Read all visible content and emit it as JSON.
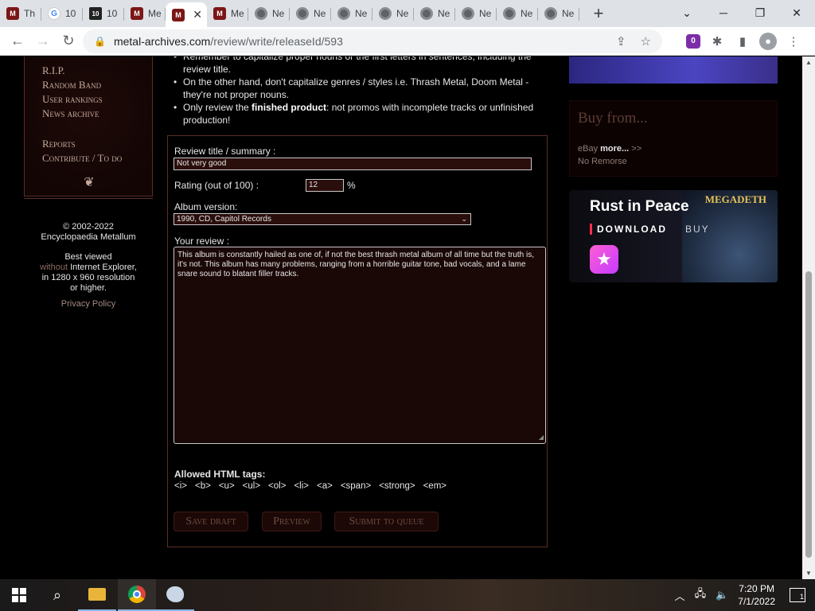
{
  "browser": {
    "tabs": [
      {
        "label": "Th",
        "icon": "ma"
      },
      {
        "label": "10",
        "icon": "g"
      },
      {
        "label": "10",
        "icon": "ten"
      },
      {
        "label": "Me",
        "icon": "ma"
      },
      {
        "label": "",
        "icon": "ma",
        "active": true
      },
      {
        "label": "Me",
        "icon": "ma"
      },
      {
        "label": "Ne",
        "icon": "ch"
      },
      {
        "label": "Ne",
        "icon": "ch"
      },
      {
        "label": "Ne",
        "icon": "ch"
      },
      {
        "label": "Ne",
        "icon": "ch"
      },
      {
        "label": "Ne",
        "icon": "ch"
      },
      {
        "label": "Ne",
        "icon": "ch"
      },
      {
        "label": "Ne",
        "icon": "ch"
      },
      {
        "label": "Ne",
        "icon": "ch"
      }
    ],
    "new_tab": "+",
    "url_host": "metal-archives.com",
    "url_path": "/review/write/releaseId/593",
    "ext_badge": "0"
  },
  "sidebar": {
    "menu": [
      "R.I.P.",
      "Random Band",
      "User rankings",
      "News archive",
      "Reports",
      "Contribute / To do"
    ],
    "copyright_line1": "© 2002-2022",
    "copyright_line2": "Encyclopaedia Metallum",
    "best_viewed_1": "Best viewed",
    "best_viewed_without": "without",
    "best_viewed_2": " Internet Explorer,",
    "best_viewed_3": "in 1280 x 960 resolution",
    "best_viewed_4": "or higher.",
    "privacy": "Privacy Policy"
  },
  "guidelines": {
    "item1": "Remember to capitalize proper nouns or the first letters in sentences, including the review title.",
    "item2": "On the other hand, don't capitalize genres / styles i.e. Thrash Metal, Doom Metal - they're not proper nouns.",
    "item3_pre": "Only review the ",
    "item3_bold": "finished product",
    "item3_post": ": not promos with incomplete tracks or unfinished production!"
  },
  "form": {
    "title_label": "Review title / summary :",
    "title_value": "Not very good",
    "rating_label": "Rating (out of 100) :",
    "rating_value": "12",
    "rating_unit": "%",
    "album_label": "Album version:",
    "album_value": "1990, CD, Capitol Records",
    "review_label": "Your review :",
    "review_text": "This album is constantly hailed as one of, if not the best thrash metal album of all time but the truth is, it's not. This album has many problems, ranging from a horrible guitar tone, bad vocals, and a lame snare sound to blatant filler tracks.",
    "allowed_label": "Allowed HTML tags:",
    "tags": [
      "<i>",
      "<b>",
      "<u>",
      "<ul>",
      "<ol>",
      "<li>",
      "<a>",
      "<span>",
      "<strong>",
      "<em>"
    ],
    "save_draft": "Save draft",
    "preview": "Preview",
    "submit": "Submit to queue"
  },
  "right": {
    "buy_title": "Buy from...",
    "ebay": "eBay ",
    "more": "more...",
    "arrows": " >>",
    "no_remorse": "No Remorse",
    "ad_title": "Rust in Peace",
    "ad_band": "MEGADETH",
    "ad_download": "DOWNLOAD",
    "ad_buy": "BUY"
  },
  "taskbar": {
    "time": "7:20 PM",
    "date": "7/1/2022",
    "notif_count": "1"
  }
}
